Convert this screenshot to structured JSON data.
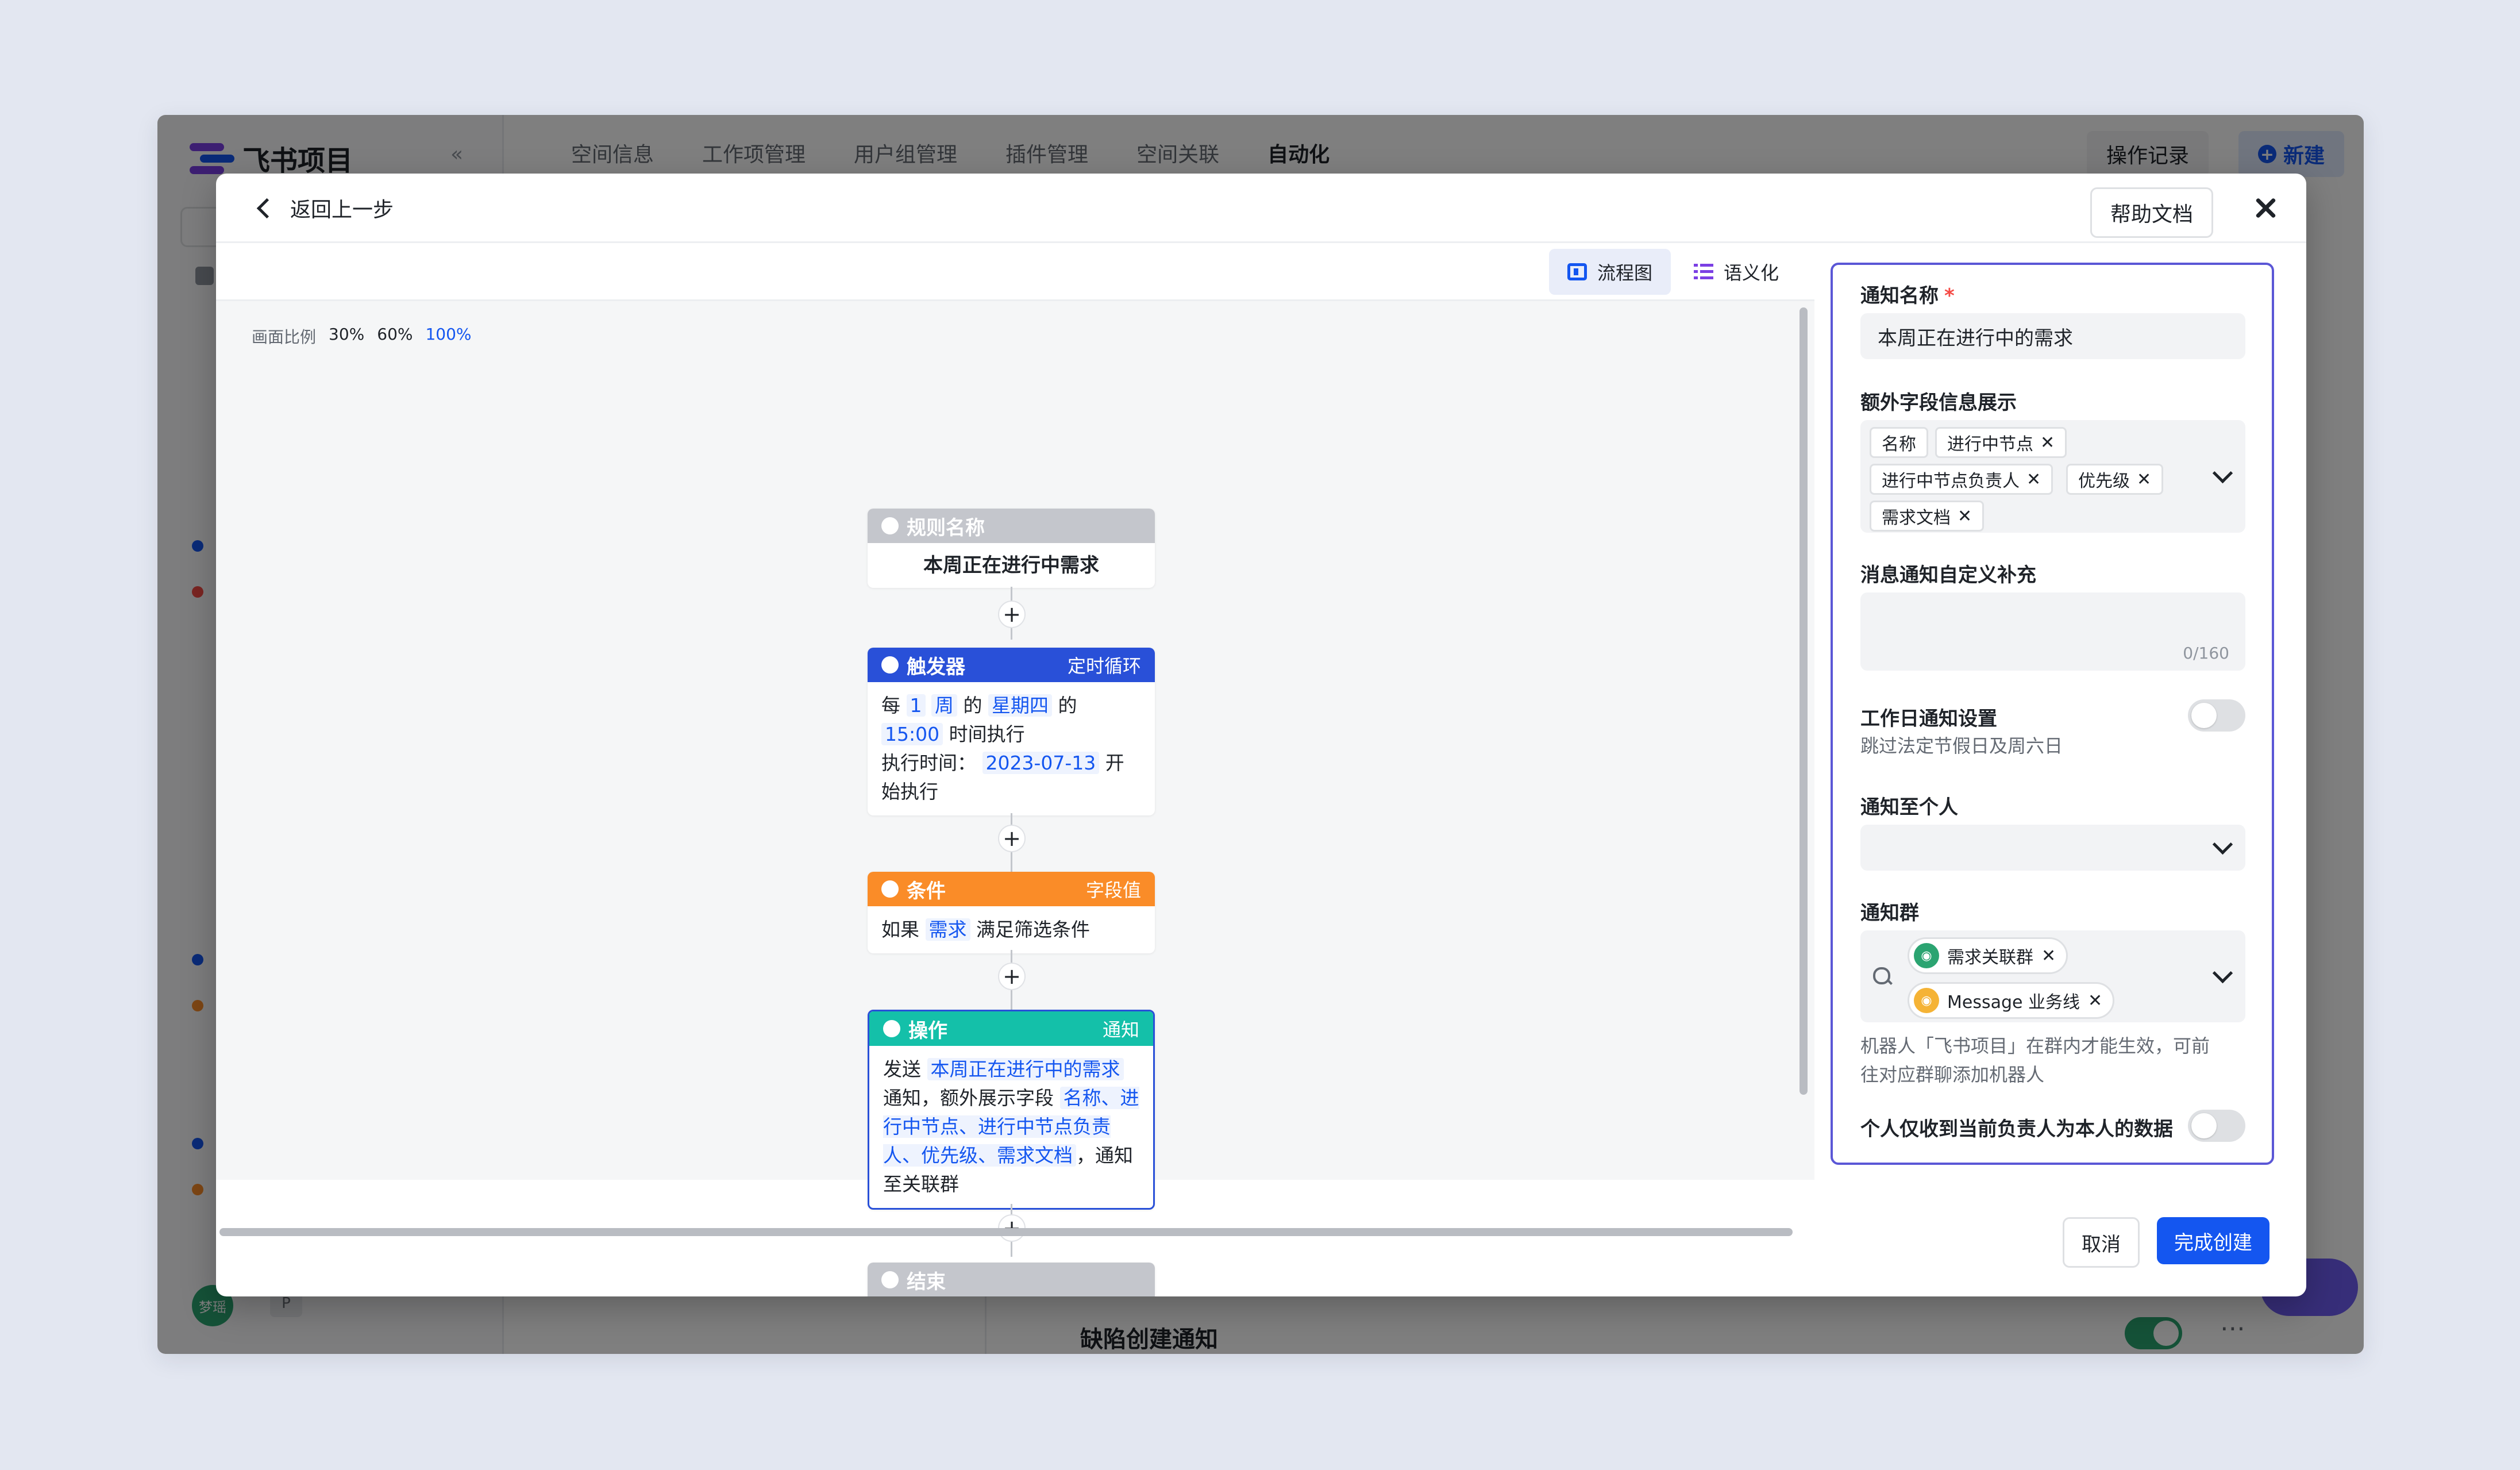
{
  "app": {
    "logo_text": "飞书项目",
    "tabs": [
      "空间信息",
      "工作项管理",
      "用户组管理",
      "插件管理",
      "空间关联",
      "自动化"
    ],
    "active_tab_index": 5,
    "log_button": "操作记录",
    "new_button": "新建",
    "avatar_text": "梦瑶",
    "workspace_badge": "P",
    "bottom_rule_name": "缺陷创建通知",
    "bottom_rule_enabled": true,
    "brand_color": "#1456f0"
  },
  "modal": {
    "back_label": "返回上一步",
    "help_button": "帮助文档",
    "view_flowchart": "流程图",
    "view_semantic": "语义化",
    "zoom_label": "画面比例",
    "zoom_levels": [
      "30%",
      "60%",
      "100%"
    ],
    "zoom_active": "100%",
    "cancel_button": "取消",
    "submit_button": "完成创建"
  },
  "flow": {
    "rule": {
      "header": "规则名称",
      "name": "本周正在进行中需求",
      "color": "#c4c6cc"
    },
    "trigger": {
      "header": "触发器",
      "type": "定时循环",
      "color": "#2950d8",
      "line1_prefix": "每",
      "count": "1",
      "unit": "周",
      "of1": "的",
      "weekday": "星期四",
      "of2": "的",
      "time": "15:00",
      "line1_suffix": "时间执行",
      "exec_label": "执行时间：",
      "exec_date": "2023-07-13",
      "exec_suffix": "开始执行"
    },
    "condition": {
      "header": "条件",
      "type": "字段值",
      "color": "#fa8c28",
      "prefix": "如果",
      "object": "需求",
      "suffix": "满足筛选条件"
    },
    "action": {
      "header": "操作",
      "type": "通知",
      "color": "#14c0a9",
      "prefix": "发送",
      "notice_name": "本周正在进行中的需求",
      "mid": "通知，额外展示字段",
      "fields": "名称、进行中节点、进行中节点负责人、优先级、需求文档",
      "suffix": "，通知至关联群"
    },
    "end": {
      "header": "结束",
      "color": "#c4c6cc"
    }
  },
  "form": {
    "notice_name_label": "通知名称",
    "notice_name_value": "本周正在进行中的需求",
    "extra_fields_label": "额外字段信息展示",
    "extra_fields_tags": [
      "名称",
      "进行中节点",
      "进行中节点负责人",
      "优先级",
      "需求文档"
    ],
    "custom_msg_label": "消息通知自定义补充",
    "custom_msg_counter": "0/160",
    "workday_label": "工作日通知设置",
    "workday_hint": "跳过法定节假日及周六日",
    "workday_enabled": false,
    "notify_person_label": "通知至个人",
    "notify_group_label": "通知群",
    "groups": [
      "需求关联群",
      "Message 业务线"
    ],
    "group_hint_line1": "机器人「飞书项目」在群内才能生效，可前",
    "group_hint_line2": "往对应群聊添加机器人",
    "owner_only_label": "个人仅收到当前负责人为本人的数据",
    "owner_only_enabled": false,
    "panel_border_color": "#5b57d6"
  }
}
